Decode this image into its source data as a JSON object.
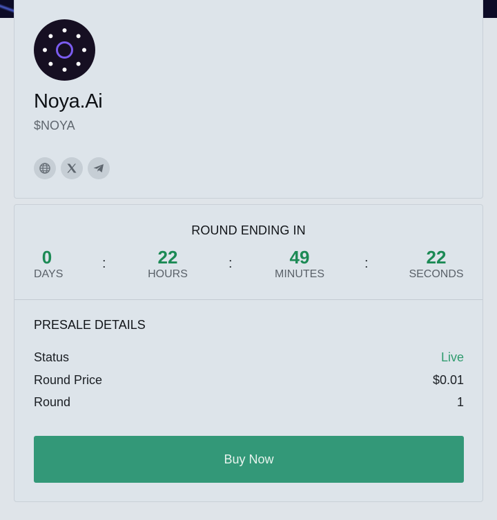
{
  "colors": {
    "accent_green": "#339878",
    "countdown_green": "#1c8a55",
    "live_green": "#2f9b6e",
    "card_bg": "#dde4ea",
    "page_bg": "#dfe4e9"
  },
  "token": {
    "logo_icon": "dotted-ring-logo",
    "name": "Noya.Ai",
    "symbol": "$NOYA",
    "socials": [
      {
        "icon": "globe-icon"
      },
      {
        "icon": "x-icon"
      },
      {
        "icon": "telegram-icon"
      }
    ]
  },
  "countdown": {
    "title": "ROUND ENDING IN",
    "separator": ":",
    "units": [
      {
        "value": "0",
        "label": "DAYS"
      },
      {
        "value": "22",
        "label": "HOURS"
      },
      {
        "value": "49",
        "label": "MINUTES"
      },
      {
        "value": "22",
        "label": "SECONDS"
      }
    ]
  },
  "presale": {
    "title": "PRESALE DETAILS",
    "rows": [
      {
        "label": "Status",
        "value": "Live"
      },
      {
        "label": "Round Price",
        "value": "$0.01"
      },
      {
        "label": "Round",
        "value": "1"
      }
    ],
    "buy_label": "Buy Now"
  }
}
